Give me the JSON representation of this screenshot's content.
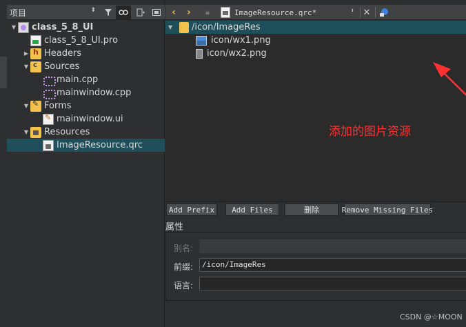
{
  "sidebar": {
    "combo_label": "项目",
    "items": [
      {
        "label": "class_5_8_UI",
        "icon": "project-icon",
        "bold": true,
        "expand": "▼",
        "depth": 0
      },
      {
        "label": "class_5_8_UI.pro",
        "icon": "pro-file-icon",
        "depth": 1,
        "expand": ""
      },
      {
        "label": "Headers",
        "icon": "headers-folder-icon",
        "depth": 1,
        "expand": "▶"
      },
      {
        "label": "Sources",
        "icon": "sources-folder-icon",
        "depth": 1,
        "expand": "▼"
      },
      {
        "label": "main.cpp",
        "icon": "cpp-file-icon",
        "depth": 2,
        "expand": ""
      },
      {
        "label": "mainwindow.cpp",
        "icon": "cpp-file-icon",
        "depth": 2,
        "expand": ""
      },
      {
        "label": "Forms",
        "icon": "forms-folder-icon",
        "depth": 1,
        "expand": "▼"
      },
      {
        "label": "mainwindow.ui",
        "icon": "ui-file-icon",
        "depth": 2,
        "expand": ""
      },
      {
        "label": "Resources",
        "icon": "resources-folder-icon",
        "depth": 1,
        "expand": "▼"
      },
      {
        "label": "ImageResource.qrc",
        "icon": "qrc-file-icon",
        "depth": 2,
        "expand": "",
        "selected": true
      }
    ]
  },
  "editor": {
    "file_name": "ImageResource.qrc*",
    "prefix": "/icon/ImageRes",
    "files": [
      "icon/wx1.png",
      "icon/wx2.png"
    ],
    "annotation": "添加的图片资源",
    "buttons": {
      "add_prefix": "Add Prefix",
      "add_files": "Add Files",
      "delete": "删除",
      "remove_missing": "Remove Missing Files"
    },
    "properties": {
      "title": "属性",
      "alias_label": "别名:",
      "prefix_label": "前缀:",
      "prefix_value": "/icon/ImageRes",
      "language_label": "语言:"
    }
  },
  "watermark": "CSDN @☆MOON",
  "colors": {
    "selection": "#1f4f5a",
    "annotation": "#ff3030",
    "nav_arrow": "#e8b54a"
  }
}
